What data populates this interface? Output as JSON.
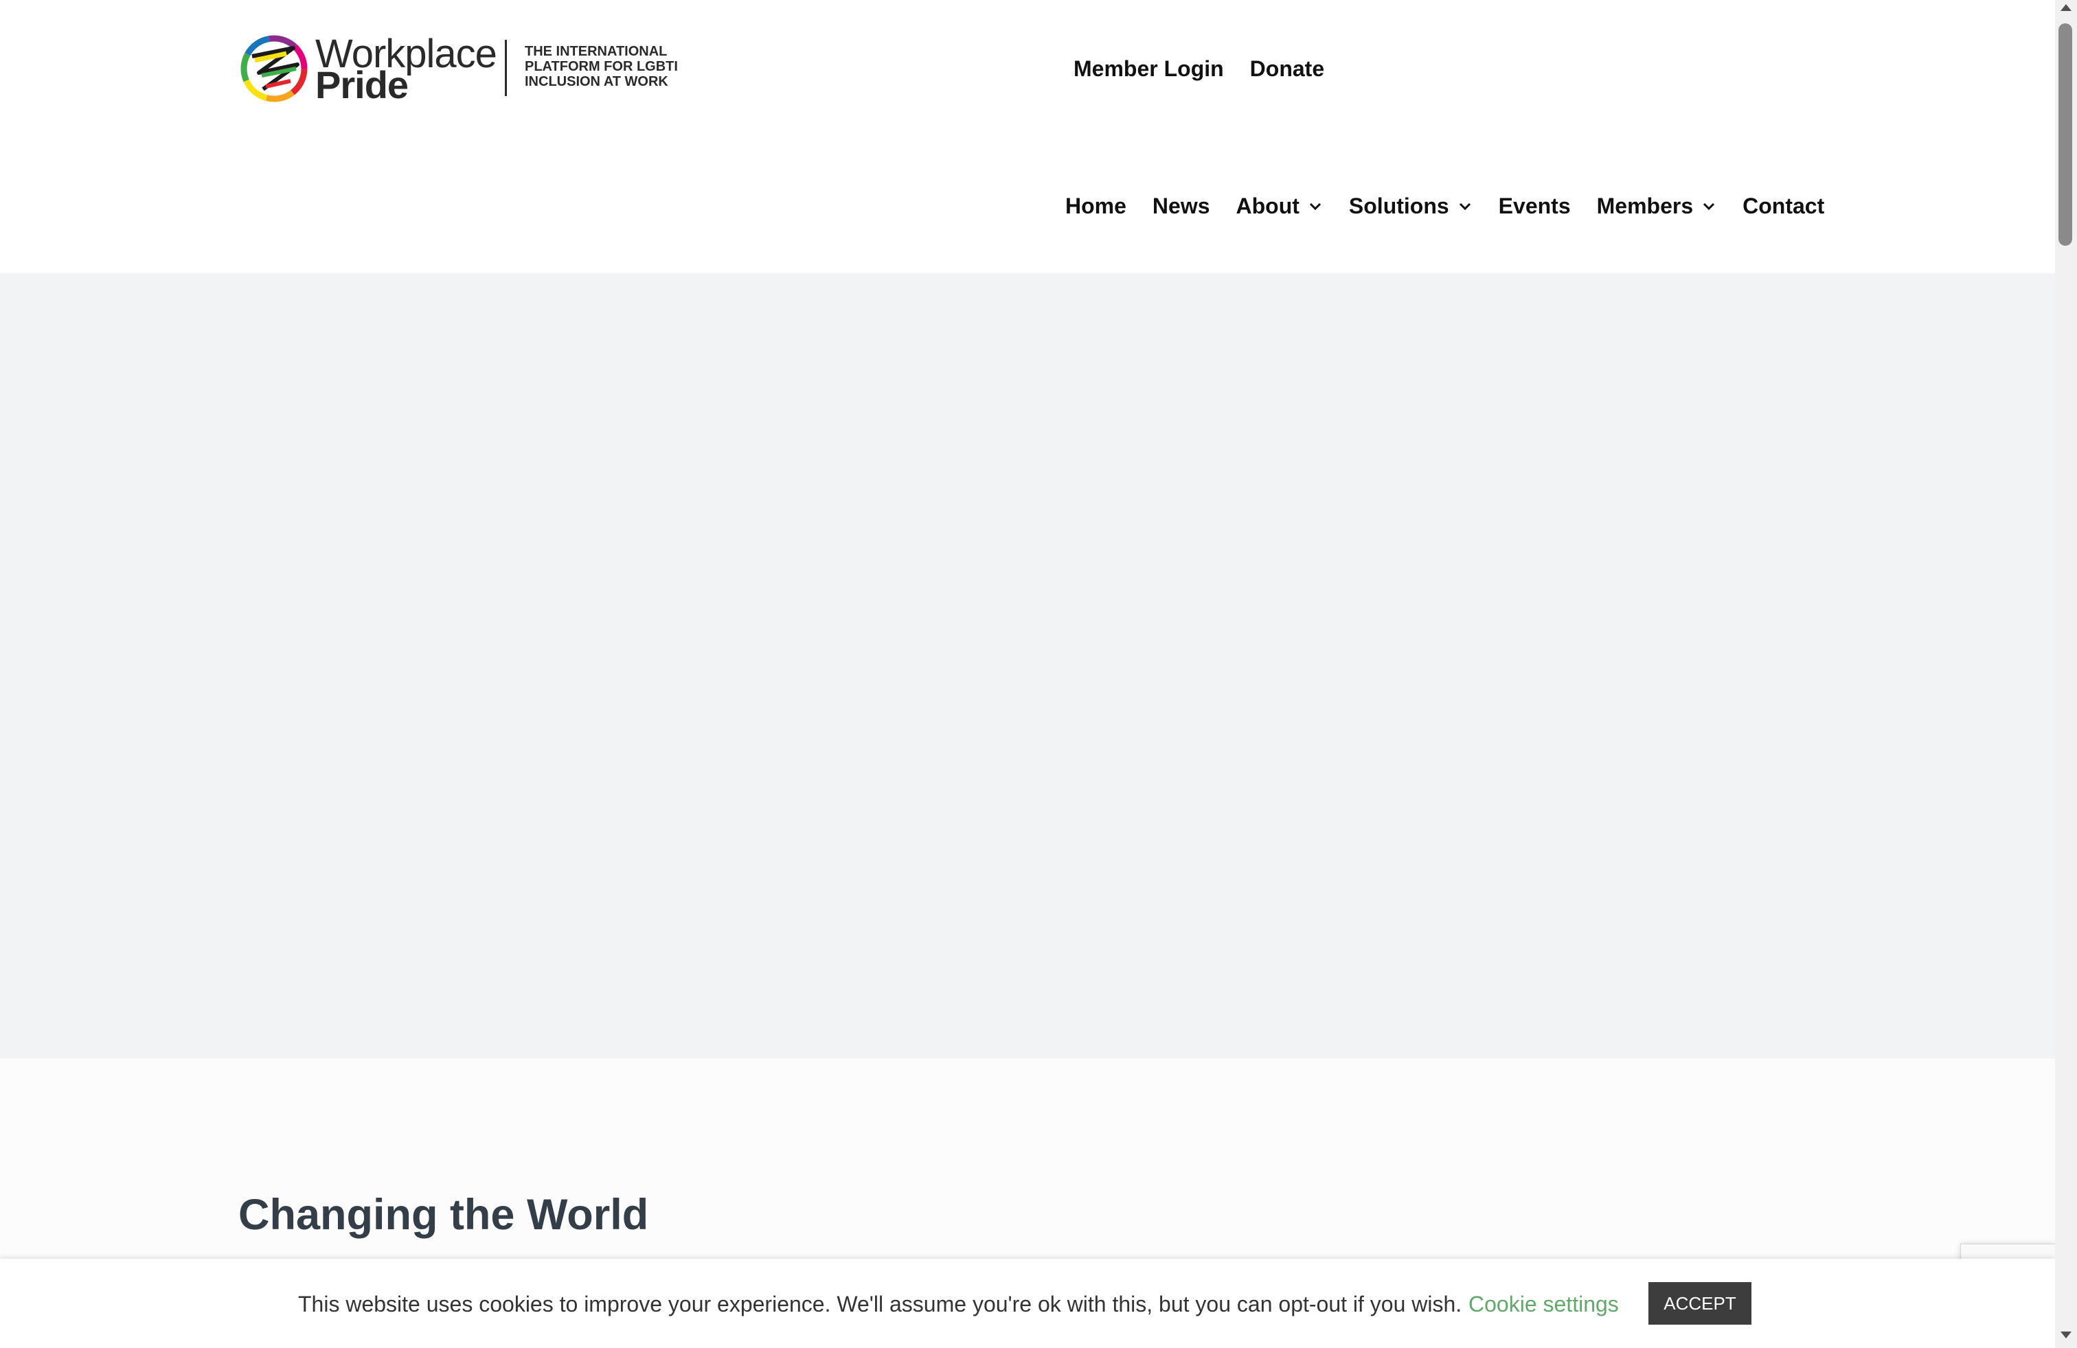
{
  "brand": {
    "name_line1": "Workplace",
    "name_line2": "Pride",
    "tagline": [
      "THE INTERNATIONAL",
      "PLATFORM FOR LGBTI",
      "INCLUSION AT WORK"
    ],
    "logo_colors": [
      "#e3262b",
      "#f7a51d",
      "#fbe10f",
      "#3fae49",
      "#1b75bb",
      "#8a2b8d",
      "#e4007d"
    ]
  },
  "top_links": {
    "member_login": "Member Login",
    "donate": "Donate"
  },
  "nav": {
    "items": [
      {
        "label": "Home",
        "dropdown": false
      },
      {
        "label": "News",
        "dropdown": false
      },
      {
        "label": "About",
        "dropdown": true
      },
      {
        "label": "Solutions",
        "dropdown": true
      },
      {
        "label": "Events",
        "dropdown": false
      },
      {
        "label": "Members",
        "dropdown": true
      },
      {
        "label": "Contact",
        "dropdown": false
      }
    ]
  },
  "content": {
    "heading": "Changing the World"
  },
  "cookie": {
    "message": "This website uses cookies to improve your experience. We'll assume you're ok with this, but you can opt-out if you wish.",
    "settings_label": "Cookie settings",
    "accept_label": "ACCEPT",
    "settings_color": "#62a86b"
  }
}
